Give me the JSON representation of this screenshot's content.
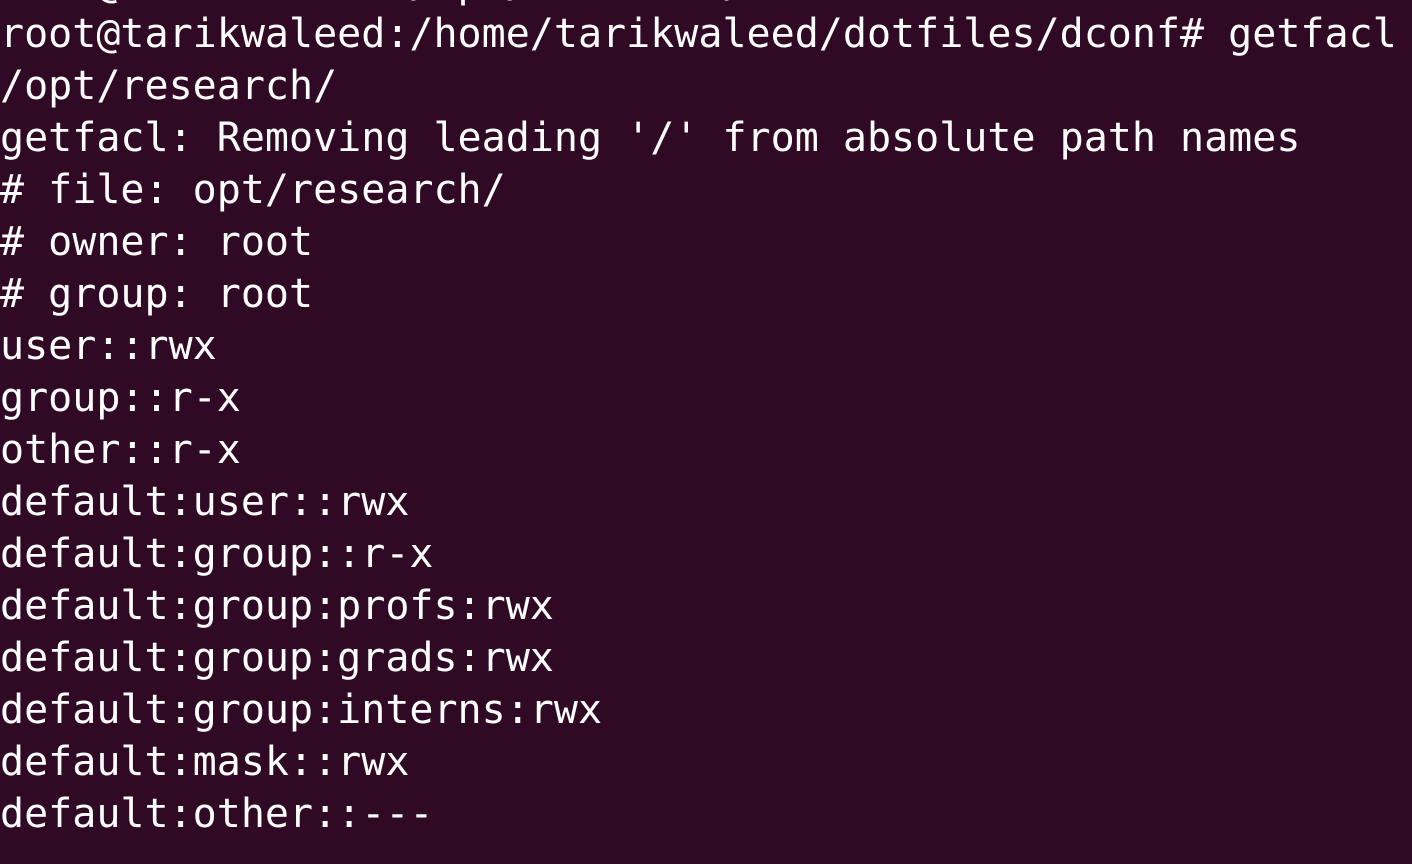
{
  "terminal": {
    "partial_line": "root@tarikwaleed:/opt/research/",
    "lines": [
      "root@tarikwaleed:/home/tarikwaleed/dotfiles/dconf# getfacl",
      "/opt/research/",
      "getfacl: Removing leading '/' from absolute path names",
      "# file: opt/research/",
      "# owner: root",
      "# group: root",
      "user::rwx",
      "group::r-x",
      "other::r-x",
      "default:user::rwx",
      "default:group::r-x",
      "default:group:profs:rwx",
      "default:group:grads:rwx",
      "default:group:interns:rwx",
      "default:mask::rwx",
      "default:other::---"
    ]
  },
  "colors": {
    "background": "#300a24",
    "text": "#ffffff"
  }
}
